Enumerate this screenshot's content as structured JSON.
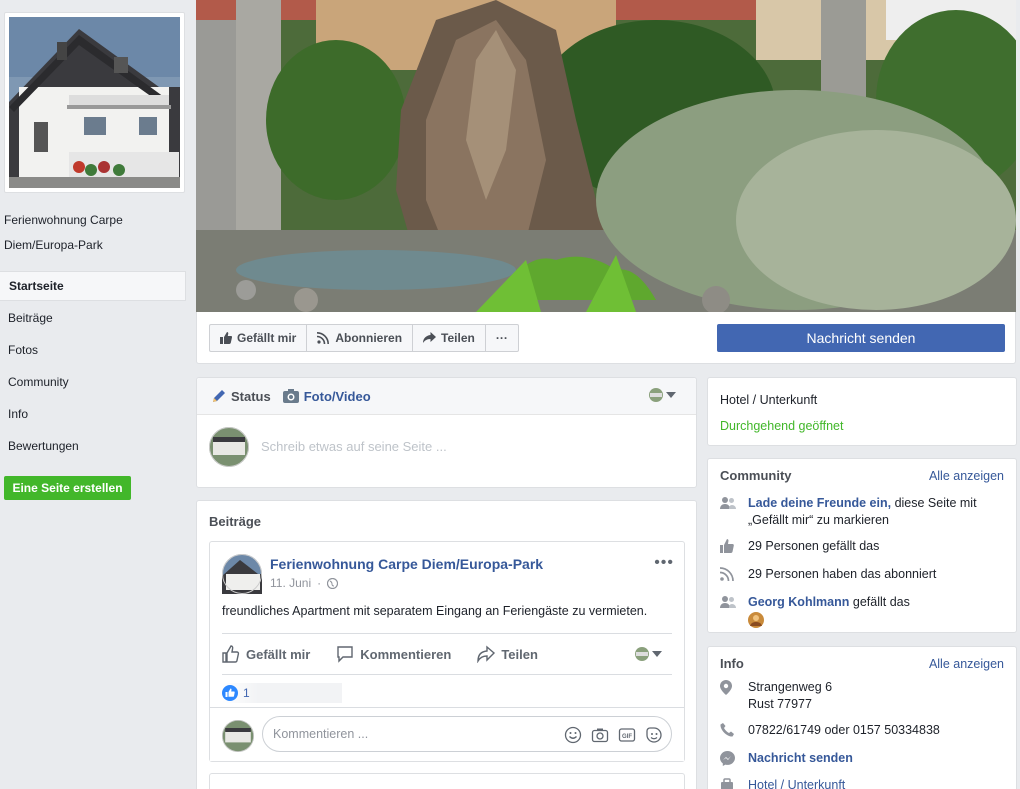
{
  "page": {
    "name": "Ferienwohnung Carpe Diem/Europa-Park"
  },
  "nav": {
    "items": [
      {
        "label": "Startseite"
      },
      {
        "label": "Beiträge"
      },
      {
        "label": "Fotos"
      },
      {
        "label": "Community"
      },
      {
        "label": "Info"
      },
      {
        "label": "Bewertungen"
      }
    ],
    "create_page": "Eine Seite erstellen"
  },
  "actions": {
    "like": "Gefällt mir",
    "follow": "Abonnieren",
    "share": "Teilen",
    "more": "···",
    "message": "Nachricht senden"
  },
  "composer": {
    "status": "Status",
    "photo": "Foto/Video",
    "placeholder": "Schreib etwas auf seine Seite ..."
  },
  "posts": {
    "title": "Beiträge",
    "items": [
      {
        "author": "Ferienwohnung Carpe Diem/Europa-Park",
        "date": "11. Juni",
        "text": "freundliches Apartment mit separatem Eingang an Feriengäste zu vermieten.",
        "like": "Gefällt mir",
        "comment": "Kommentieren",
        "share": "Teilen",
        "likes": "1",
        "comment_placeholder": "Kommentieren ..."
      }
    ]
  },
  "category_box": {
    "category": "Hotel / Unterkunft",
    "hours": "Durchgehend geöffnet"
  },
  "community": {
    "title": "Community",
    "see_all": "Alle anzeigen",
    "invite_link": "Lade deine Freunde ein,",
    "invite_rest": " diese Seite mit „Gefällt mir“ zu markieren",
    "likes_text": "29 Personen gefällt das",
    "follows_text": "29 Personen haben das abonniert",
    "friend_name": "Georg Kohlmann",
    "friend_text": " gefällt das"
  },
  "info": {
    "title": "Info",
    "see_all": "Alle anzeigen",
    "street": "Strangenweg 6",
    "city": "Rust 77977",
    "phone": "07822/61749 oder 0157 50334838",
    "message": "Nachricht senden",
    "category": "Hotel / Unterkunft"
  },
  "colors": {
    "brand": "#4267b2",
    "link": "#365899",
    "green": "#42b72a",
    "background": "#e9ebee"
  }
}
